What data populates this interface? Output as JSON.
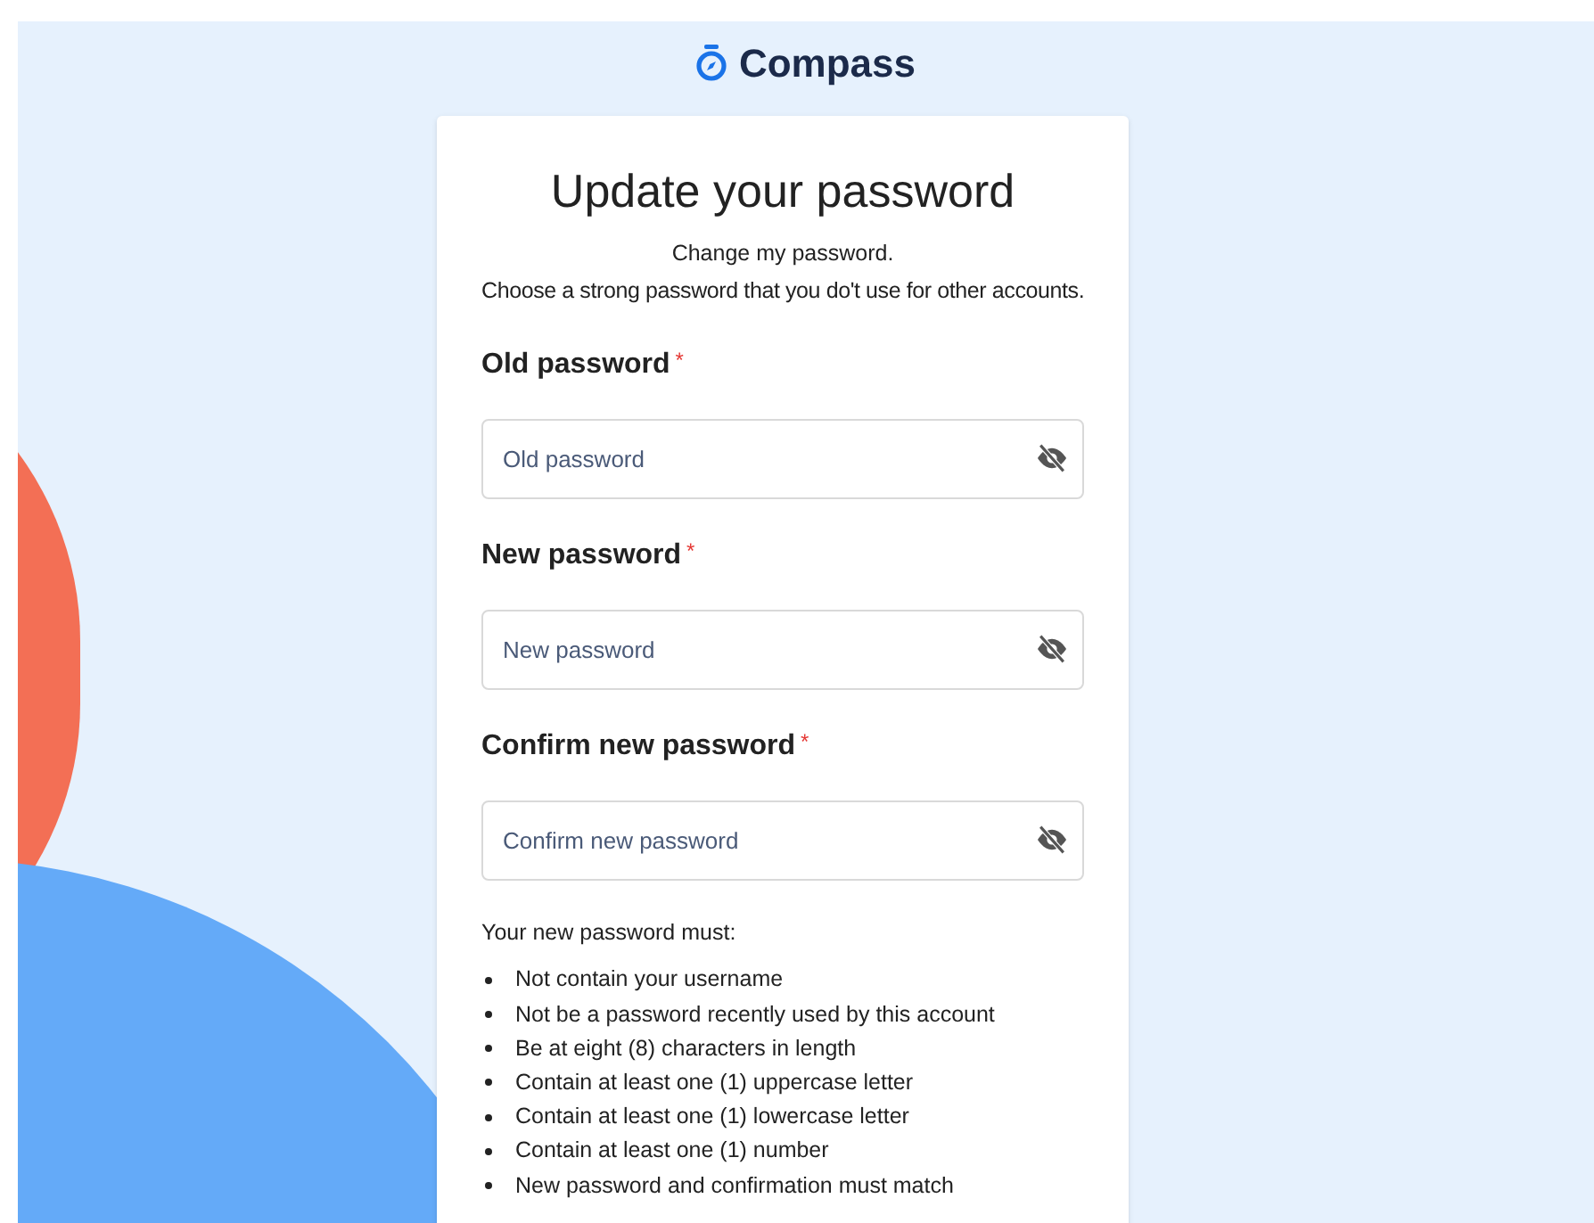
{
  "brand": {
    "name": "Compass"
  },
  "card": {
    "title": "Update your password",
    "subtitle": "Change my password.",
    "description": "Choose a strong password that you do't use for other accounts.",
    "fields": [
      {
        "label": "Old password",
        "required_mark": "*",
        "placeholder": "Old password"
      },
      {
        "label": "New password",
        "required_mark": "*",
        "placeholder": "New password"
      },
      {
        "label": "Confirm new password",
        "required_mark": "*",
        "placeholder": "Confirm new password"
      }
    ],
    "rules_heading": "Your new password must:",
    "rules": [
      "Not contain your username",
      "Not be a password recently used by this account",
      "Be at eight (8) characters in length",
      "Contain at least one (1) uppercase letter",
      "Contain at least one (1) lowercase letter",
      "Contain at least one (1) number",
      "New password and confirmation must match"
    ]
  }
}
